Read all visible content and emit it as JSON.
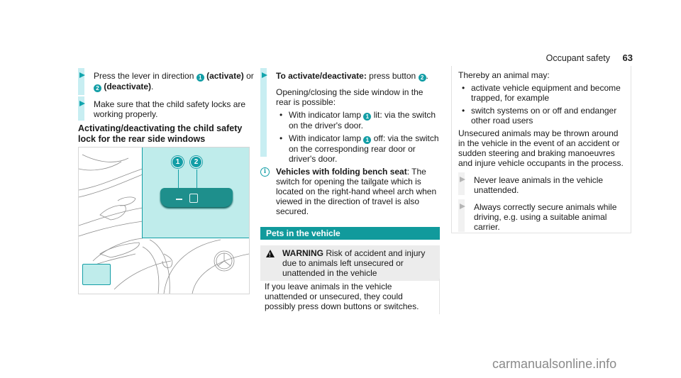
{
  "header": {
    "section": "Occupant safety",
    "page_number": "63"
  },
  "left": {
    "steps": [
      {
        "text_pre": "Press the lever in direction ",
        "num1": "1",
        "b1": "(activate)",
        "mid": " or ",
        "num2": "2",
        "b2": "(deactivate)",
        "post": "."
      },
      {
        "text": "Make sure that the child safety locks are working properly."
      }
    ],
    "heading": "Activating/deactivating the child safety lock for the rear side windows",
    "illustration": {
      "callouts": [
        "1",
        "2"
      ],
      "alt": "Driver's door switch panel with child safety lock button"
    }
  },
  "middle": {
    "step": {
      "b": "To activate/deactivate:",
      "text": " press button ",
      "num": "2",
      "post": "."
    },
    "para": "Opening/closing the side window in the rear is possible:",
    "bullets": [
      {
        "pre": "With indicator lamp ",
        "num": "1",
        "post": " lit: via the switch on the driver's door."
      },
      {
        "pre": "With indicator lamp ",
        "num": "1",
        "post": " off: via the switch on the corresponding rear door or driver's door."
      }
    ],
    "info": {
      "b": "Vehicles with folding bench seat",
      "text": ": The switch for opening the tailgate which is located on the right-hand wheel arch when viewed in the direction of travel is also secured."
    },
    "section_title": "Pets in the vehicle",
    "warning": {
      "label": "WARNING",
      "text": " Risk of accident and injury due to animals left unsecured or unattended in the vehicle"
    },
    "warning_body": "If you leave animals in the vehicle unattended or unsecured, they could possibly press down buttons or switches."
  },
  "right": {
    "intro": "Thereby an animal may:",
    "bullets": [
      "activate vehicle equipment and become trapped, for example",
      "switch systems on or off and endanger other road users"
    ],
    "para": "Unsecured animals may be thrown around in the vehicle in the event of an accident or sudden steering and braking manoeuvres and injure vehicle occupants in the process.",
    "steps": [
      "Never leave animals in the vehicle unattended.",
      "Always correctly secure animals while driving, e.g. using a suitable animal carrier."
    ]
  },
  "footer": {
    "watermark": "carmanualsonline.info"
  }
}
